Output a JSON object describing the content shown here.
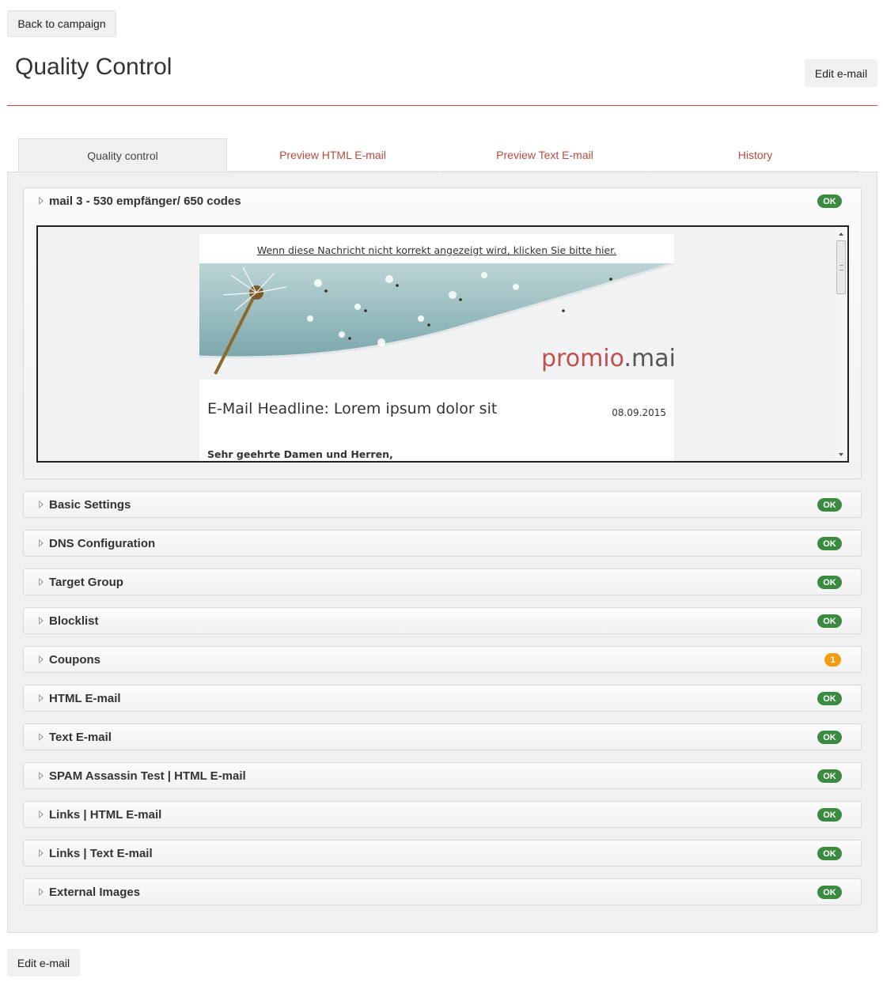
{
  "header": {
    "back_label": "Back to campaign",
    "title": "Quality Control",
    "edit_label": "Edit e-mail"
  },
  "tabs": [
    {
      "label": "Quality control",
      "active": true
    },
    {
      "label": "Preview HTML E-mail",
      "active": false
    },
    {
      "label": "Preview Text E-mail",
      "active": false
    },
    {
      "label": "History",
      "active": false
    }
  ],
  "mail_section": {
    "title": "mail 3 - 530 empfänger/ 650 codes",
    "status": "OK",
    "preview": {
      "view_link": "Wenn diese Nachricht nicht korrekt angezeigt wird, klicken Sie bitte hier.",
      "brand": "promio.mail",
      "headline": "E-Mail Headline: Lorem ipsum dolor sit",
      "date": "08.09.2015",
      "greeting": "Sehr geehrte Damen und Herren,"
    }
  },
  "checks": [
    {
      "label": "Basic Settings",
      "status": "OK",
      "kind": "ok"
    },
    {
      "label": "DNS Configuration",
      "status": "OK",
      "kind": "ok"
    },
    {
      "label": "Target Group",
      "status": "OK",
      "kind": "ok"
    },
    {
      "label": "Blocklist",
      "status": "OK",
      "kind": "ok"
    },
    {
      "label": "Coupons",
      "status": "1",
      "kind": "warn"
    },
    {
      "label": "HTML E-mail",
      "status": "OK",
      "kind": "ok"
    },
    {
      "label": "Text E-mail",
      "status": "OK",
      "kind": "ok"
    },
    {
      "label": "SPAM Assassin Test | HTML E-mail",
      "status": "OK",
      "kind": "ok"
    },
    {
      "label": "Links | HTML E-mail",
      "status": "OK",
      "kind": "ok"
    },
    {
      "label": "Links | Text E-mail",
      "status": "OK",
      "kind": "ok"
    },
    {
      "label": "External Images",
      "status": "OK",
      "kind": "ok"
    }
  ],
  "footer": {
    "edit_label": "Edit e-mail"
  },
  "colors": {
    "accent": "#b94a3d",
    "ok": "#3a8a41",
    "warn": "#f39c12"
  }
}
